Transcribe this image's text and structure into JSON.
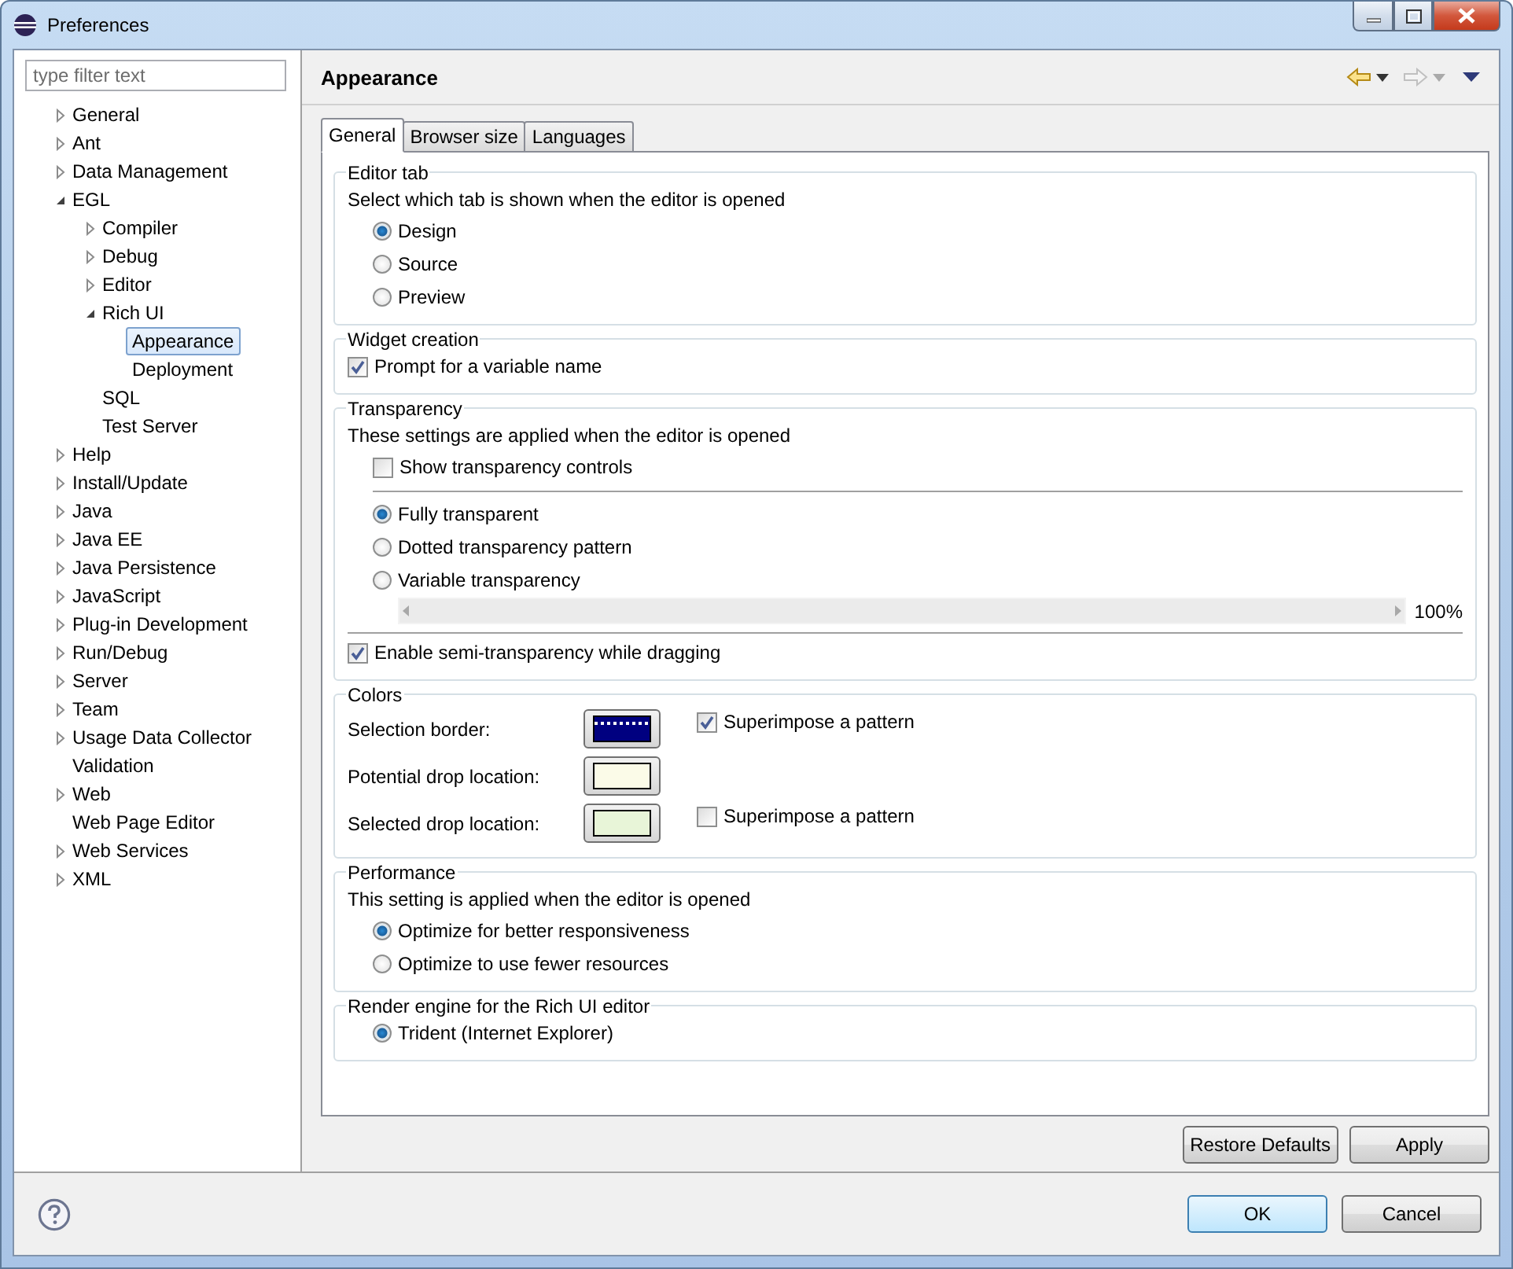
{
  "window": {
    "title": "Preferences"
  },
  "filter": {
    "placeholder": "type filter text"
  },
  "tree": [
    {
      "label": "General",
      "expanded": false,
      "selected": false
    },
    {
      "label": "Ant",
      "expanded": false,
      "selected": false
    },
    {
      "label": "Data Management",
      "expanded": false,
      "selected": false
    },
    {
      "label": "EGL",
      "expanded": true,
      "selected": false,
      "children": [
        {
          "label": "Compiler",
          "expanded": false,
          "selected": false
        },
        {
          "label": "Debug",
          "expanded": false,
          "selected": false
        },
        {
          "label": "Editor",
          "expanded": false,
          "selected": false
        },
        {
          "label": "Rich UI",
          "expanded": true,
          "selected": false,
          "children": [
            {
              "label": "Appearance",
              "selected": true
            },
            {
              "label": "Deployment",
              "selected": false
            }
          ]
        },
        {
          "label": "SQL",
          "selected": false
        },
        {
          "label": "Test Server",
          "selected": false
        }
      ]
    },
    {
      "label": "Help",
      "expanded": false,
      "selected": false
    },
    {
      "label": "Install/Update",
      "expanded": false,
      "selected": false
    },
    {
      "label": "Java",
      "expanded": false,
      "selected": false
    },
    {
      "label": "Java EE",
      "expanded": false,
      "selected": false
    },
    {
      "label": "Java Persistence",
      "expanded": false,
      "selected": false
    },
    {
      "label": "JavaScript",
      "expanded": false,
      "selected": false
    },
    {
      "label": "Plug-in Development",
      "expanded": false,
      "selected": false
    },
    {
      "label": "Run/Debug",
      "expanded": false,
      "selected": false
    },
    {
      "label": "Server",
      "expanded": false,
      "selected": false
    },
    {
      "label": "Team",
      "expanded": false,
      "selected": false
    },
    {
      "label": "Usage Data Collector",
      "expanded": false,
      "selected": false
    },
    {
      "label": "Validation",
      "selected": false
    },
    {
      "label": "Web",
      "expanded": false,
      "selected": false
    },
    {
      "label": "Web Page Editor",
      "selected": false
    },
    {
      "label": "Web Services",
      "expanded": false,
      "selected": false
    },
    {
      "label": "XML",
      "expanded": false,
      "selected": false
    }
  ],
  "page": {
    "title": "Appearance"
  },
  "tabs": [
    {
      "label": "General",
      "selected": true
    },
    {
      "label": "Browser size",
      "selected": false
    },
    {
      "label": "Languages",
      "selected": false
    }
  ],
  "sections": [
    {
      "title": "Editor tab",
      "rows": [
        {
          "kind": "text",
          "text": "Select which tab is shown when the editor is opened"
        },
        {
          "kind": "radio",
          "label": "Design",
          "selected": true
        },
        {
          "kind": "radio",
          "label": "Source",
          "selected": false
        },
        {
          "kind": "radio",
          "label": "Preview",
          "selected": false
        }
      ]
    },
    {
      "title": "Widget creation",
      "rows": [
        {
          "kind": "flush_checkbox",
          "label": "Prompt for a variable name",
          "checked": true
        }
      ]
    },
    {
      "title": "Transparency",
      "rows": [
        {
          "kind": "text",
          "text": "These settings are applied when the editor is opened"
        },
        {
          "kind": "checkbox",
          "label": "Show transparency controls",
          "checked": false
        },
        {
          "kind": "separator"
        },
        {
          "kind": "radio",
          "label": "Fully transparent",
          "selected": true
        },
        {
          "kind": "radio",
          "label": "Dotted transparency pattern",
          "selected": false
        },
        {
          "kind": "radio",
          "label": "Variable transparency",
          "selected": false
        },
        {
          "kind": "scale",
          "reading": "100%"
        },
        {
          "kind": "rule"
        },
        {
          "kind": "flush_checkbox",
          "label": "Enable semi-transparency while dragging",
          "checked": true
        }
      ]
    },
    {
      "title": "Colors",
      "rows": [
        {
          "kind": "color",
          "label": "Selection border:",
          "color": "#000080",
          "option": {
            "label": "Superimpose a pattern",
            "checked": true
          }
        },
        {
          "kind": "color",
          "label": "Potential drop location:",
          "color": "#fbfbe8"
        },
        {
          "kind": "color",
          "label": "Selected drop location:",
          "color": "#e8f5d8",
          "option": {
            "label": "Superimpose a pattern",
            "checked": false
          }
        }
      ]
    },
    {
      "title": "Performance",
      "rows": [
        {
          "kind": "text",
          "text": "This setting is applied when the editor is opened"
        },
        {
          "kind": "radio",
          "label": "Optimize for better responsiveness",
          "selected": true
        },
        {
          "kind": "radio",
          "label": "Optimize to use fewer resources",
          "selected": false
        }
      ]
    },
    {
      "title": "Render engine for the Rich UI editor",
      "rows": [
        {
          "kind": "radio",
          "label": "Trident (Internet Explorer)",
          "selected": true
        }
      ]
    }
  ],
  "page_buttons": [
    {
      "label": "Restore Defaults"
    },
    {
      "label": "Apply"
    }
  ],
  "dialog_buttons": [
    {
      "label": "OK",
      "default": true
    },
    {
      "label": "Cancel",
      "default": false
    }
  ]
}
